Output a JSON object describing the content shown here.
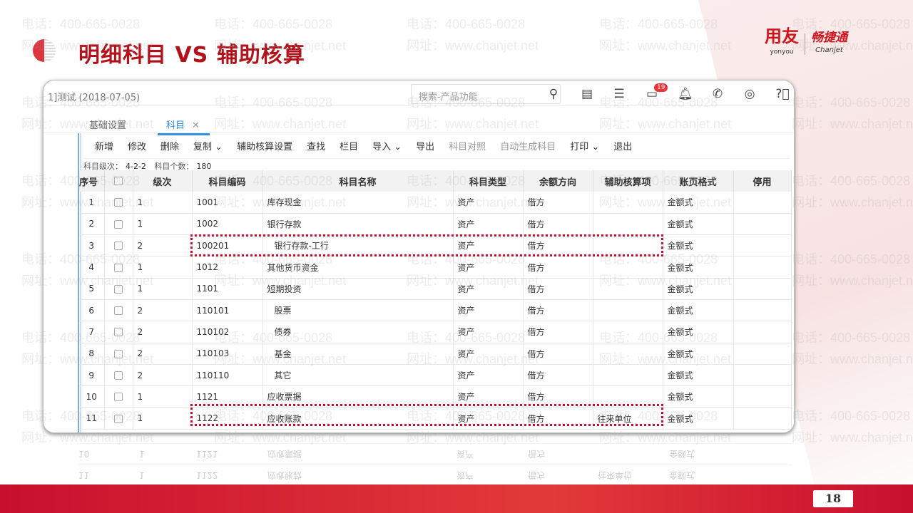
{
  "slide": {
    "title": "明细科目 VS 辅助核算",
    "page_number": "18"
  },
  "brand": {
    "yonyou_cn": "用友",
    "yonyou_en": "yonyou",
    "chanjet_cn": "畅捷通",
    "chanjet_en": "Chanjet"
  },
  "watermark": {
    "phone": "电话：400-665-0028",
    "site": "网址：www.chanjet.net"
  },
  "app": {
    "account": "1]测试 (2018-07-05)",
    "search_placeholder": "搜索-产品功能",
    "badge_count": "19",
    "tabs": [
      {
        "label": "基础设置"
      },
      {
        "label": "科目"
      }
    ],
    "toolbar": [
      "新增",
      "修改",
      "删除",
      "复制 ⌄",
      "辅助核算设置",
      "查找",
      "栏目",
      "导入 ⌄",
      "导出",
      "科目对照",
      "自动生成科目",
      "打印 ⌄",
      "退出"
    ],
    "info": {
      "level_label": "科目级次：",
      "level_value": "4-2-2",
      "count_label": "科目个数：",
      "count_value": "180"
    },
    "columns": [
      "序号",
      "",
      "级次",
      "科目编码",
      "科目名称",
      "科目类型",
      "余额方向",
      "辅助核算项",
      "账页格式",
      "停用"
    ],
    "rows": [
      [
        "1",
        "1",
        "1001",
        "库存现金",
        "资产",
        "借方",
        "",
        "金额式"
      ],
      [
        "2",
        "1",
        "1002",
        "银行存款",
        "资产",
        "借方",
        "",
        "金额式"
      ],
      [
        "3",
        "2",
        "100201",
        "银行存款-工行",
        "资产",
        "借方",
        "",
        "金额式"
      ],
      [
        "4",
        "1",
        "1012",
        "其他货币资金",
        "资产",
        "借方",
        "",
        "金额式"
      ],
      [
        "5",
        "1",
        "1101",
        "短期投资",
        "资产",
        "借方",
        "",
        "金额式"
      ],
      [
        "6",
        "2",
        "110101",
        "股票",
        "资产",
        "借方",
        "",
        "金额式"
      ],
      [
        "7",
        "2",
        "110102",
        "债券",
        "资产",
        "借方",
        "",
        "金额式"
      ],
      [
        "8",
        "2",
        "110103",
        "基金",
        "资产",
        "借方",
        "",
        "金额式"
      ],
      [
        "9",
        "2",
        "110110",
        "其它",
        "资产",
        "借方",
        "",
        "金额式"
      ],
      [
        "10",
        "1",
        "1121",
        "应收票据",
        "资产",
        "借方",
        "",
        "金额式"
      ],
      [
        "11",
        "1",
        "1122",
        "应收账款",
        "资产",
        "借方",
        "往来单位",
        "金额式"
      ]
    ]
  }
}
